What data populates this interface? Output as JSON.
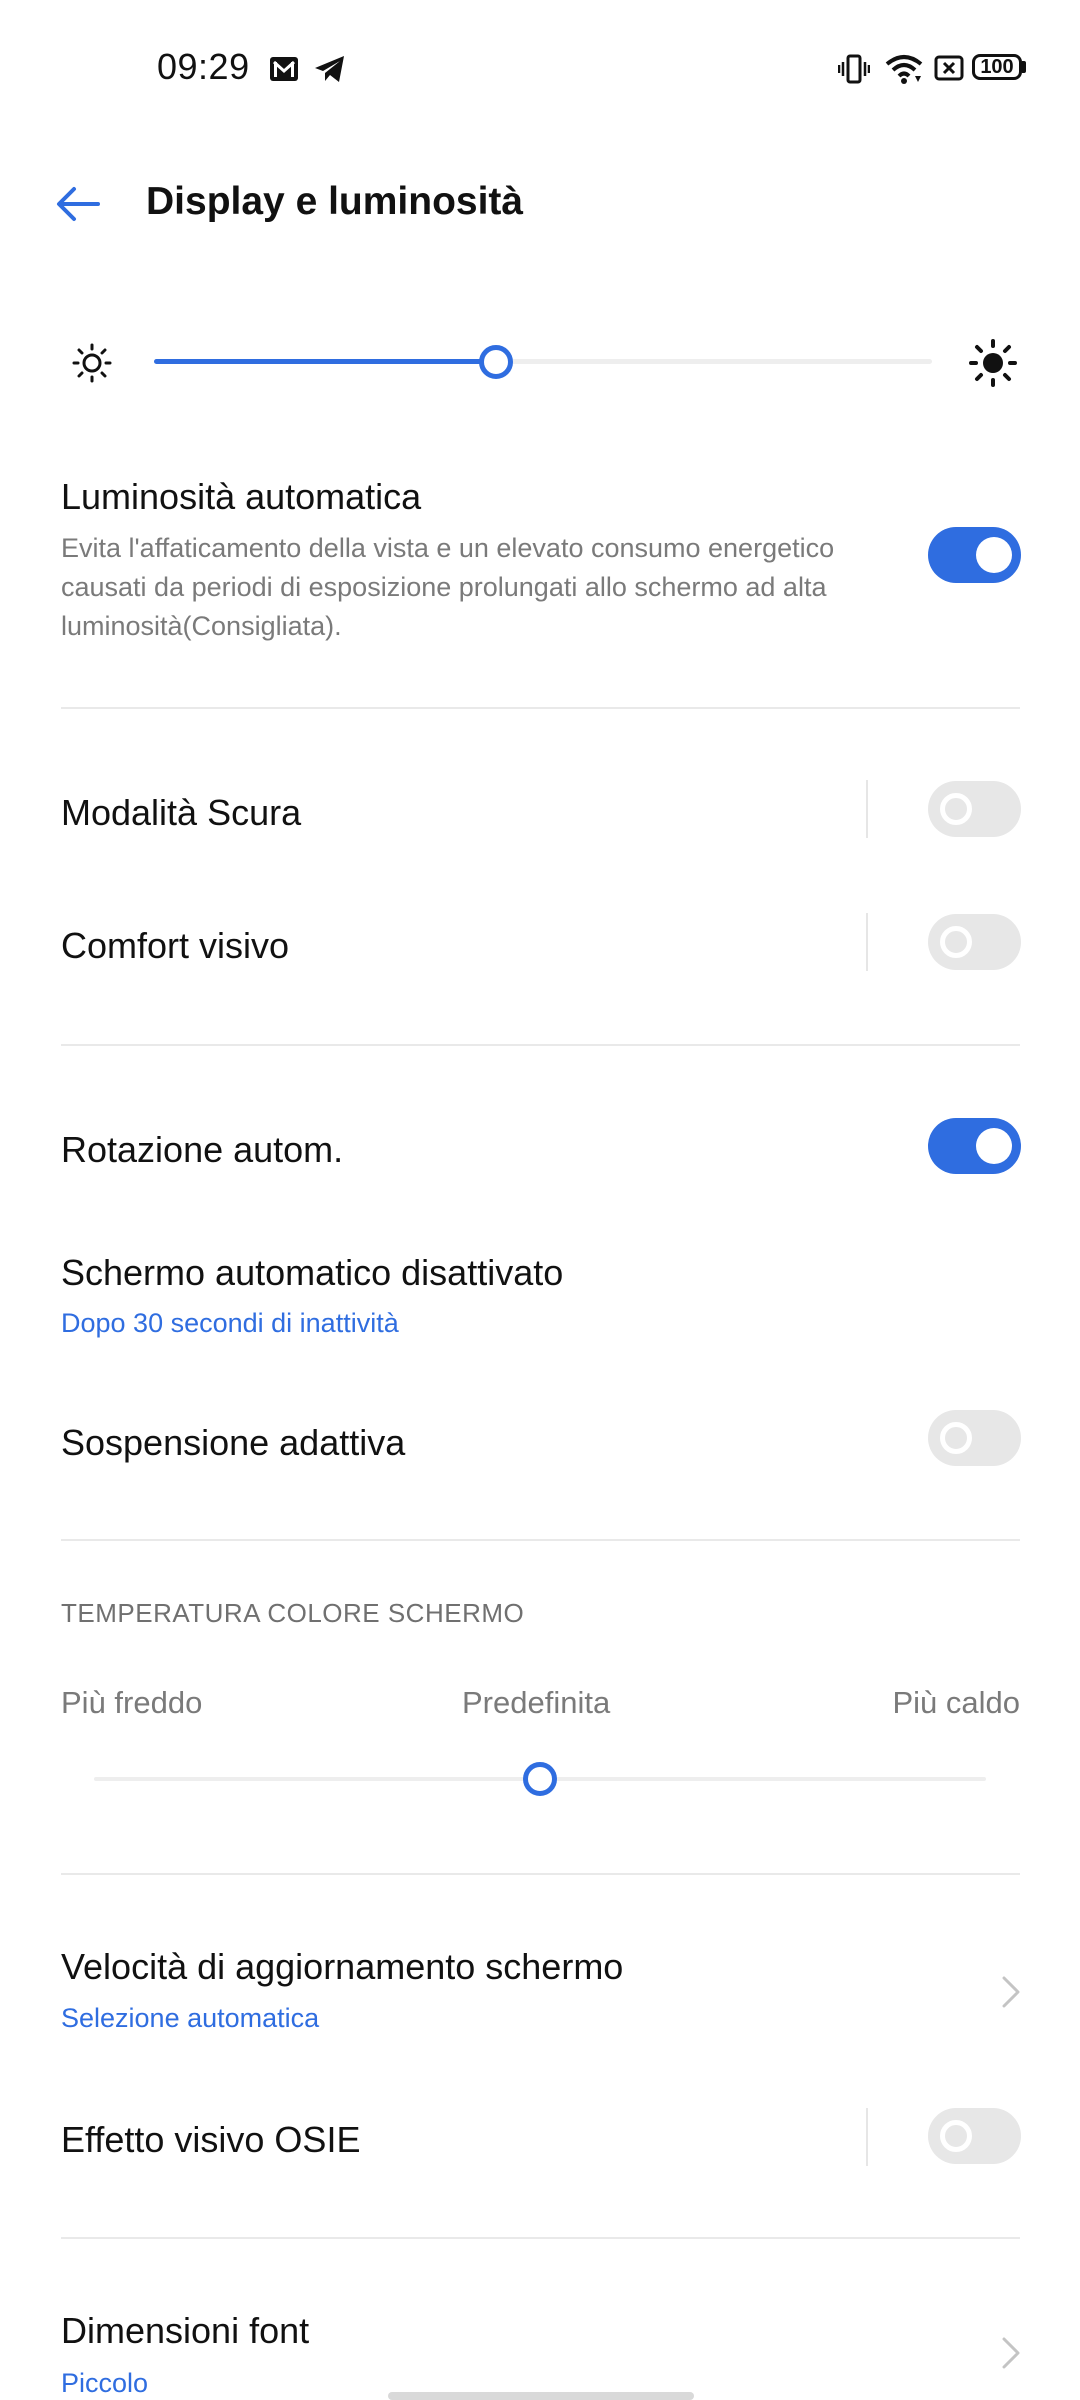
{
  "status_bar": {
    "time": "09:29",
    "battery": "100",
    "icons": [
      "gmail-icon",
      "telegram-icon",
      "vibrate-icon",
      "wifi-icon",
      "sim-icon",
      "battery-icon"
    ]
  },
  "header": {
    "title": "Display e luminosità",
    "back_icon": "back-arrow-icon"
  },
  "brightness": {
    "level": 0.44,
    "min_icon": "sun-low-icon",
    "max_icon": "sun-high-icon"
  },
  "auto_brightness": {
    "title": "Luminosità automatica",
    "description": "Evita l'affaticamento della vista e un elevato consumo energetico causati da periodi di esposizione prolungati allo schermo ad alta luminosità(Consigliata).",
    "enabled": true
  },
  "dark_mode": {
    "title": "Modalità Scura",
    "enabled": false
  },
  "eye_comfort": {
    "title": "Comfort visivo",
    "enabled": false
  },
  "auto_rotate": {
    "title": "Rotazione autom.",
    "enabled": true
  },
  "screen_timeout": {
    "title": "Schermo automatico disattivato",
    "value": "Dopo 30 secondi di inattività"
  },
  "adaptive_sleep": {
    "title": "Sospensione adattiva",
    "enabled": false
  },
  "color_temperature": {
    "header": "TEMPERATURA COLORE SCHERMO",
    "cold_label": "Più freddo",
    "default_label": "Predefinita",
    "warm_label": "Più caldo",
    "level": 0.5
  },
  "refresh_rate": {
    "title": "Velocità di aggiornamento schermo",
    "value": "Selezione automatica"
  },
  "osie": {
    "title": "Effetto visivo OSIE",
    "enabled": false
  },
  "font_size": {
    "title": "Dimensioni font",
    "value": "Piccolo"
  },
  "colors": {
    "accent": "#2f6de0",
    "toggle_off": "#e7e7e7",
    "divider": "#e9e9e9"
  }
}
